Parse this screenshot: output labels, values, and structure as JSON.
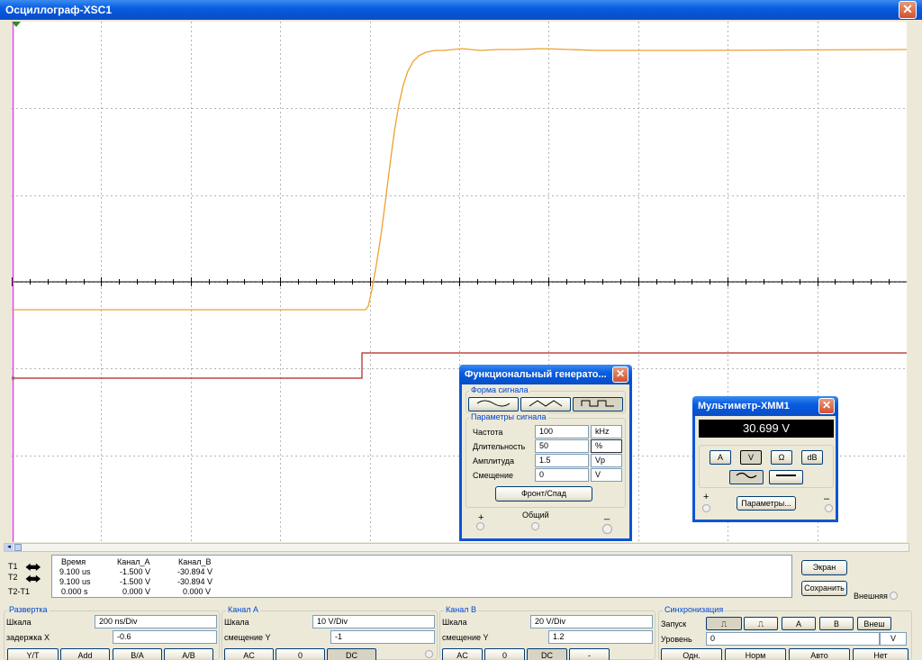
{
  "oscilloscope": {
    "title": "Осциллограф-XSC1",
    "t1_label": "T1",
    "t2_label": "T2",
    "t21_label": "T2-T1",
    "measurements": {
      "headers": [
        "Время",
        "Канал_A",
        "Канал_B"
      ],
      "rows": [
        [
          "9.100 us",
          "-1.500 V",
          "-30.894 V"
        ],
        [
          "9.100 us",
          "-1.500 V",
          "-30.894 V"
        ],
        [
          "0.000 s",
          "0.000 V",
          "0.000 V"
        ]
      ]
    },
    "screen_button": "Экран",
    "save_button": "Сохранить",
    "external_label": "Внешняя",
    "timebase": {
      "legend": "Развертка",
      "scale_label": "Шкала",
      "scale_value": "200 ns/Div",
      "delay_label": "задержка X",
      "delay_value": "-0.6",
      "buttons": [
        "Y/T",
        "Add",
        "B/A",
        "A/B"
      ]
    },
    "channel_a": {
      "legend": "Канал А",
      "scale_label": "Шкала",
      "scale_value": "10  V/Div",
      "offset_label": "смещение Y",
      "offset_value": "-1",
      "buttons": [
        "AC",
        "0",
        "DC"
      ]
    },
    "channel_b": {
      "legend": "Канал В",
      "scale_label": "Шкала",
      "scale_value": "20  V/Div",
      "offset_label": "смещение Y",
      "offset_value": "1.2",
      "buttons": [
        "AC",
        "0",
        "DC",
        "-"
      ]
    },
    "trigger": {
      "legend": "Синхронизация",
      "edge_label": "Запуск",
      "edge_buttons": [
        "A",
        "B",
        "Внеш"
      ],
      "level_label": "Уровень",
      "level_value": "0",
      "level_unit": "V",
      "mode_buttons": [
        "Одн.",
        "Норм",
        "Авто",
        "Нет"
      ]
    },
    "colors": {
      "trace_a": "#f0a030",
      "trace_b": "#b02020",
      "grid": "#c8c8c8"
    }
  },
  "function_generator": {
    "title": "Функциональный генерато...",
    "waveform_legend": "Форма сигнала",
    "params_legend": "Параметры сигнала",
    "params": [
      {
        "label": "Частота",
        "value": "100",
        "unit": "kHz"
      },
      {
        "label": "Длительность",
        "value": "50",
        "unit": "%"
      },
      {
        "label": "Амплитуда",
        "value": "1.5",
        "unit": "Vp"
      },
      {
        "label": "Смещение",
        "value": "0",
        "unit": "V"
      }
    ],
    "rise_fall_button": "Фронт/Спад",
    "plus": "+",
    "common": "Общий",
    "minus": "_"
  },
  "multimeter": {
    "title": "Мультиметр-XMM1",
    "display": "30.699 V",
    "modes": [
      "A",
      "V",
      "Ω",
      "dB"
    ],
    "params_button": "Параметры...",
    "plus": "+",
    "minus": "–"
  }
}
